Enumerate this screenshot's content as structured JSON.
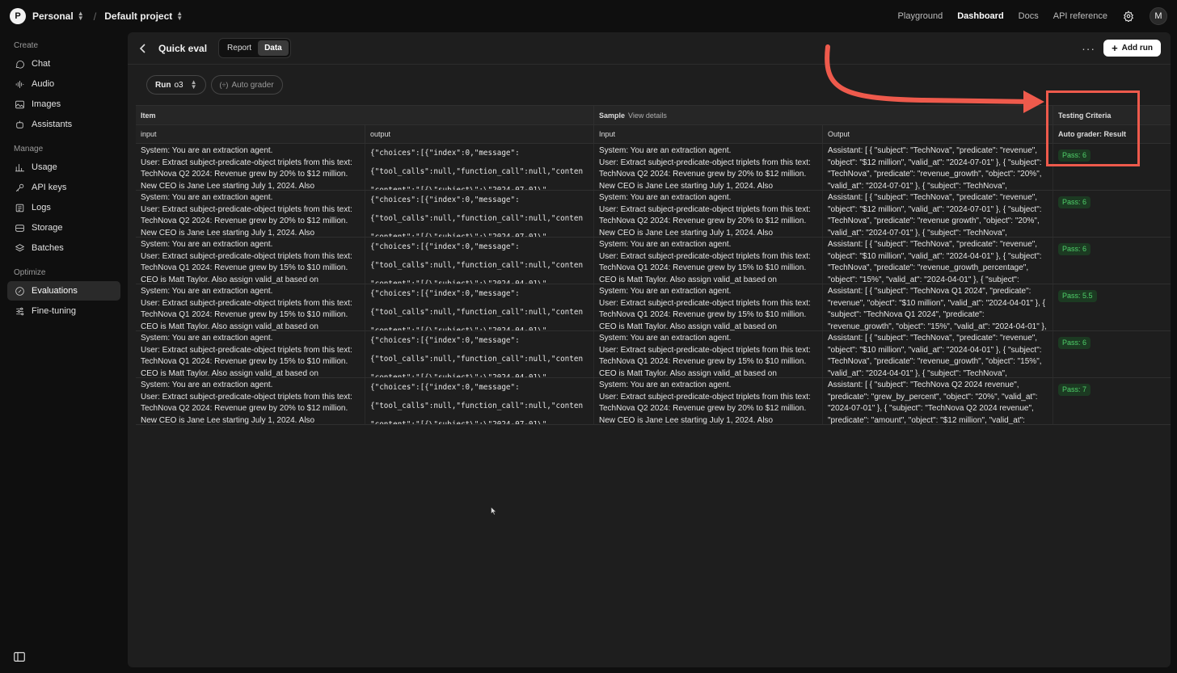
{
  "topbar": {
    "org_initial": "P",
    "org_name": "Personal",
    "project_name": "Default project",
    "nav": [
      "Playground",
      "Dashboard",
      "Docs",
      "API reference"
    ],
    "active_nav": "Dashboard",
    "user_initial": "M"
  },
  "sidebar": {
    "sections": [
      {
        "title": "Create",
        "items": [
          {
            "label": "Chat",
            "icon": "chat-icon"
          },
          {
            "label": "Audio",
            "icon": "audio-icon"
          },
          {
            "label": "Images",
            "icon": "image-icon"
          },
          {
            "label": "Assistants",
            "icon": "assistant-icon"
          }
        ]
      },
      {
        "title": "Manage",
        "items": [
          {
            "label": "Usage",
            "icon": "usage-icon"
          },
          {
            "label": "API keys",
            "icon": "key-icon"
          },
          {
            "label": "Logs",
            "icon": "logs-icon"
          },
          {
            "label": "Storage",
            "icon": "storage-icon"
          },
          {
            "label": "Batches",
            "icon": "batches-icon"
          }
        ]
      },
      {
        "title": "Optimize",
        "items": [
          {
            "label": "Evaluations",
            "icon": "evaluations-icon",
            "active": true
          },
          {
            "label": "Fine-tuning",
            "icon": "fine-tuning-icon"
          }
        ]
      }
    ]
  },
  "header": {
    "title": "Quick eval",
    "tabs": [
      "Report",
      "Data"
    ],
    "active_tab": "Data",
    "add_run_label": "Add run"
  },
  "filters": {
    "run_label": "Run",
    "run_value": "o3",
    "grader_label": "Auto grader"
  },
  "table": {
    "groups": {
      "item": "Item",
      "sample": "Sample",
      "sample_link": "View details",
      "criteria": "Testing Criteria"
    },
    "columns": [
      "input",
      "output",
      "Input",
      "Output",
      "Auto grader: Result"
    ],
    "rows": [
      {
        "item_input": "System: You are an extraction agent.\nUser: Extract subject-predicate-object triplets from this text: TechNova Q2 2024: Revenue grew by 20% to $12 million. New CEO is Jane Lee starting July 1, 2024. Also",
        "item_output": "{\"choices\":[{\"index\":0,\"message\":\n{\"tool_calls\":null,\"function_call\":null,\"conten\n\"content\":\"[{\\\"subject\\\":\\\"2024-07-01\\\"",
        "sample_input": "System: You are an extraction agent.\nUser: Extract subject-predicate-object triplets from this text: TechNova Q2 2024: Revenue grew by 20% to $12 million. New CEO is Jane Lee starting July 1, 2024. Also",
        "sample_output": "Assistant: [ { \"subject\": \"TechNova\", \"predicate\": \"revenue\", \"object\": \"$12 million\", \"valid_at\": \"2024-07-01\" }, { \"subject\": \"TechNova\", \"predicate\": \"revenue_growth\", \"object\": \"20%\", \"valid_at\": \"2024-07-01\" }, { \"subject\": \"TechNova\",",
        "result": "Pass: 6"
      },
      {
        "item_input": "System: You are an extraction agent.\nUser: Extract subject-predicate-object triplets from this text: TechNova Q2 2024: Revenue grew by 20% to $12 million. New CEO is Jane Lee starting July 1, 2024. Also",
        "item_output": "{\"choices\":[{\"index\":0,\"message\":\n{\"tool_calls\":null,\"function_call\":null,\"conten\n\"content\":\"[{\\\"subject\\\":\\\"2024-07-01\\\"",
        "sample_input": "System: You are an extraction agent.\nUser: Extract subject-predicate-object triplets from this text: TechNova Q2 2024: Revenue grew by 20% to $12 million. New CEO is Jane Lee starting July 1, 2024. Also",
        "sample_output": "Assistant: [ { \"subject\": \"TechNova\", \"predicate\": \"revenue\", \"object\": \"$12 million\", \"valid_at\": \"2024-07-01\" }, { \"subject\": \"TechNova\", \"predicate\": \"revenue growth\", \"object\": \"20%\", \"valid_at\": \"2024-07-01\" }, { \"subject\": \"TechNova\",",
        "result": "Pass: 6"
      },
      {
        "item_input": "System: You are an extraction agent.\nUser: Extract subject-predicate-object triplets from this text: TechNova Q1 2024: Revenue grew by 15% to $10 million. CEO is Matt Taylor. Also assign valid_at based on",
        "item_output": "{\"choices\":[{\"index\":0,\"message\":\n{\"tool_calls\":null,\"function_call\":null,\"conten\n\"content\":\"[{\\\"subject\\\":\\\"2024-04-01\\\"",
        "sample_input": "System: You are an extraction agent.\nUser: Extract subject-predicate-object triplets from this text: TechNova Q1 2024: Revenue grew by 15% to $10 million. CEO is Matt Taylor. Also assign valid_at based on",
        "sample_output": "Assistant: [ { \"subject\": \"TechNova\", \"predicate\": \"revenue\", \"object\": \"$10 million\", \"valid_at\": \"2024-04-01\" }, { \"subject\": \"TechNova\", \"predicate\": \"revenue_growth_percentage\", \"object\": \"15%\", \"valid_at\": \"2024-04-01\" }, { \"subject\":",
        "result": "Pass: 6"
      },
      {
        "item_input": "System: You are an extraction agent.\nUser: Extract subject-predicate-object triplets from this text: TechNova Q1 2024: Revenue grew by 15% to $10 million. CEO is Matt Taylor. Also assign valid_at based on",
        "item_output": "{\"choices\":[{\"index\":0,\"message\":\n{\"tool_calls\":null,\"function_call\":null,\"conten\n\"content\":\"[{\\\"subject\\\":\\\"2024-04-01\\\"",
        "sample_input": "System: You are an extraction agent.\nUser: Extract subject-predicate-object triplets from this text: TechNova Q1 2024: Revenue grew by 15% to $10 million. CEO is Matt Taylor. Also assign valid_at based on",
        "sample_output": "Assistant: [ { \"subject\": \"TechNova Q1 2024\", \"predicate\": \"revenue\", \"object\": \"$10 million\", \"valid_at\": \"2024-04-01\" }, { \"subject\": \"TechNova Q1 2024\", \"predicate\": \"revenue_growth\", \"object\": \"15%\", \"valid_at\": \"2024-04-01\" },",
        "result": "Pass: 5.5"
      },
      {
        "item_input": "System: You are an extraction agent.\nUser: Extract subject-predicate-object triplets from this text: TechNova Q1 2024: Revenue grew by 15% to $10 million. CEO is Matt Taylor. Also assign valid_at based on",
        "item_output": "{\"choices\":[{\"index\":0,\"message\":\n{\"tool_calls\":null,\"function_call\":null,\"conten\n\"content\":\"[{\\\"subject\\\":\\\"2024-04-01\\\"",
        "sample_input": "System: You are an extraction agent.\nUser: Extract subject-predicate-object triplets from this text: TechNova Q1 2024: Revenue grew by 15% to $10 million. CEO is Matt Taylor. Also assign valid_at based on",
        "sample_output": "Assistant: [ { \"subject\": \"TechNova\", \"predicate\": \"revenue\", \"object\": \"$10 million\", \"valid_at\": \"2024-04-01\" }, { \"subject\": \"TechNova\", \"predicate\": \"revenue_growth\", \"object\": \"15%\", \"valid_at\": \"2024-04-01\" }, { \"subject\": \"TechNova\",",
        "result": "Pass: 6"
      },
      {
        "item_input": "System: You are an extraction agent.\nUser: Extract subject-predicate-object triplets from this text: TechNova Q2 2024: Revenue grew by 20% to $12 million. New CEO is Jane Lee starting July 1, 2024. Also",
        "item_output": "{\"choices\":[{\"index\":0,\"message\":\n{\"tool_calls\":null,\"function_call\":null,\"conten\n\"content\":\"[{\\\"subject\\\":\\\"2024-07-01\\\"",
        "sample_input": "System: You are an extraction agent.\nUser: Extract subject-predicate-object triplets from this text: TechNova Q2 2024: Revenue grew by 20% to $12 million. New CEO is Jane Lee starting July 1, 2024. Also",
        "sample_output": "Assistant: [ { \"subject\": \"TechNova Q2 2024 revenue\", \"predicate\": \"grew_by_percent\", \"object\": \"20%\", \"valid_at\": \"2024-07-01\" }, { \"subject\": \"TechNova Q2 2024 revenue\", \"predicate\": \"amount\", \"object\": \"$12 million\", \"valid_at\":",
        "result": "Pass: 7"
      }
    ]
  },
  "colors": {
    "accent_annotation": "#ee5a4c",
    "pass_badge_bg": "#1c3a22",
    "pass_badge_text": "#4fd06a"
  }
}
